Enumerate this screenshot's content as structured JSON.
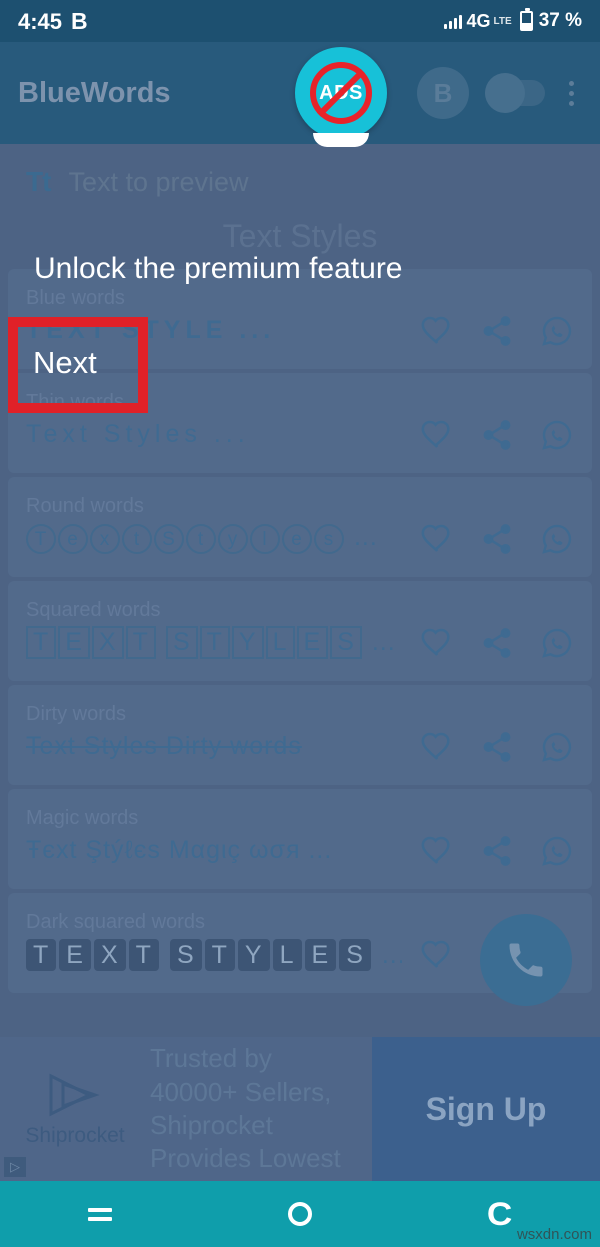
{
  "status_bar": {
    "time": "4:45",
    "time_suffix": "B",
    "network": "4G",
    "network_sub": "LTE",
    "battery_percent": "37 %"
  },
  "app_bar": {
    "title": "BlueWords",
    "no_ads_label": "ADS",
    "badge_label": "B",
    "overflow_icon": "more-vertical-icon"
  },
  "preview": {
    "icon_label": "Tt",
    "placeholder": "Text to preview"
  },
  "heading": "Text Styles",
  "styles": [
    {
      "label": "Blue words",
      "sample": "TEXT STYLE",
      "ellipsis": "...",
      "kind": "wide"
    },
    {
      "label": "Thin words",
      "sample": "Text Styles",
      "ellipsis": "...",
      "kind": "thin"
    },
    {
      "label": "Round words",
      "sample": "TextStyles",
      "ellipsis": "...",
      "kind": "round"
    },
    {
      "label": "Squared words",
      "sample": "TEXTSTYLES",
      "ellipsis": "...",
      "kind": "boxed"
    },
    {
      "label": "Dirty words",
      "sample": "Text Styles Dirty words",
      "ellipsis": "",
      "kind": "dirty"
    },
    {
      "label": "Magic words",
      "sample": "Ŧєxt Ştýℓєs Mαgιç ωσя",
      "ellipsis": "...",
      "kind": "magic"
    },
    {
      "label": "Dark squared words",
      "sample": "TEXTSTYLES",
      "ellipsis": "...",
      "kind": "dark"
    }
  ],
  "row_icons": {
    "favorite": "heart-icon",
    "share": "share-icon",
    "whatsapp": "whatsapp-icon"
  },
  "fab": {
    "icon": "phone-icon"
  },
  "ad": {
    "advertiser": "Shiprocket",
    "body": "Trusted by 40000+ Sellers, Shiprocket Provides Lowest",
    "cta": "Sign Up",
    "tag": "▷"
  },
  "nav_bar": {
    "recents": "recents-icon",
    "home": "home-icon",
    "back": "back-icon"
  },
  "tutorial": {
    "title": "Unlock the premium feature",
    "next_label": "Next"
  },
  "watermark": "wsxdn.com",
  "colors": {
    "status_bar": "#1d5070",
    "app_bar": "#285a7c",
    "content_dim": "#4d6384",
    "row_card": "#526a8b",
    "accent_cyan": "#17c1d8",
    "highlight_red": "#e02128",
    "nav_bar": "#0f9eab",
    "ad_cta": "#3c608d"
  }
}
